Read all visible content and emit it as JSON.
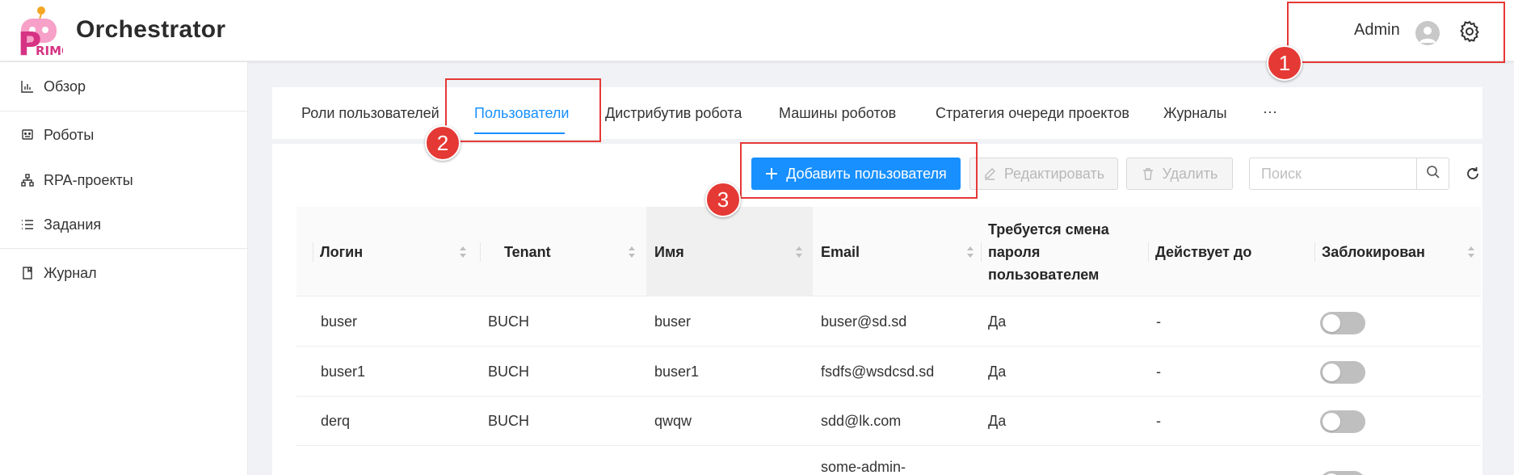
{
  "header": {
    "logo_text": "RIMO",
    "app_title": "Orchestrator",
    "user_name": "Admin",
    "avatar_icon": "user-avatar-icon",
    "settings_icon": "gear-icon"
  },
  "sidebar": {
    "items": [
      {
        "label": "Обзор",
        "icon": "bar-chart-icon"
      },
      {
        "label": "Роботы",
        "icon": "robot-icon"
      },
      {
        "label": "RPA-проекты",
        "icon": "hierarchy-icon"
      },
      {
        "label": "Задания",
        "icon": "list-icon"
      },
      {
        "label": "Журнал",
        "icon": "book-icon"
      }
    ]
  },
  "tabs": [
    {
      "label": "Роли пользователей",
      "active": false
    },
    {
      "label": "Пользователи",
      "active": true
    },
    {
      "label": "Дистрибутив робота",
      "active": false
    },
    {
      "label": "Машины роботов",
      "active": false
    },
    {
      "label": "Стратегия очереди проектов",
      "active": false
    },
    {
      "label": "Журналы",
      "active": false
    },
    {
      "label": "···",
      "active": false
    }
  ],
  "toolbar": {
    "add_label": "Добавить пользователя",
    "edit_label": "Редактировать",
    "delete_label": "Удалить",
    "search_placeholder": "Поиск"
  },
  "table": {
    "columns": [
      "Логин",
      "Tenant",
      "Имя",
      "Email",
      "Требуется смена пароля пользователем",
      "Действует до",
      "Заблокирован"
    ],
    "rows": [
      {
        "login": "buser",
        "tenant": "BUCH",
        "name": "buser",
        "email": "buser@sd.sd",
        "pwd_change": "Да",
        "valid_until": "-",
        "blocked": false
      },
      {
        "login": "buser1",
        "tenant": "BUCH",
        "name": "buser1",
        "email": "fsdfs@wsdcsd.sd",
        "pwd_change": "Да",
        "valid_until": "-",
        "blocked": false
      },
      {
        "login": "derq",
        "tenant": "BUCH",
        "name": "qwqw",
        "email": "sdd@lk.com",
        "pwd_change": "Да",
        "valid_until": "-",
        "blocked": false
      },
      {
        "login": "",
        "tenant": "",
        "name": "",
        "email": "some-admin-",
        "pwd_change": "",
        "valid_until": "",
        "blocked": false
      }
    ]
  },
  "annotations": [
    "1",
    "2",
    "3"
  ],
  "colors": {
    "primary": "#1890ff",
    "annotation": "#e53935",
    "logo_pink": "#d63384",
    "logo_orange": "#f5a623"
  }
}
